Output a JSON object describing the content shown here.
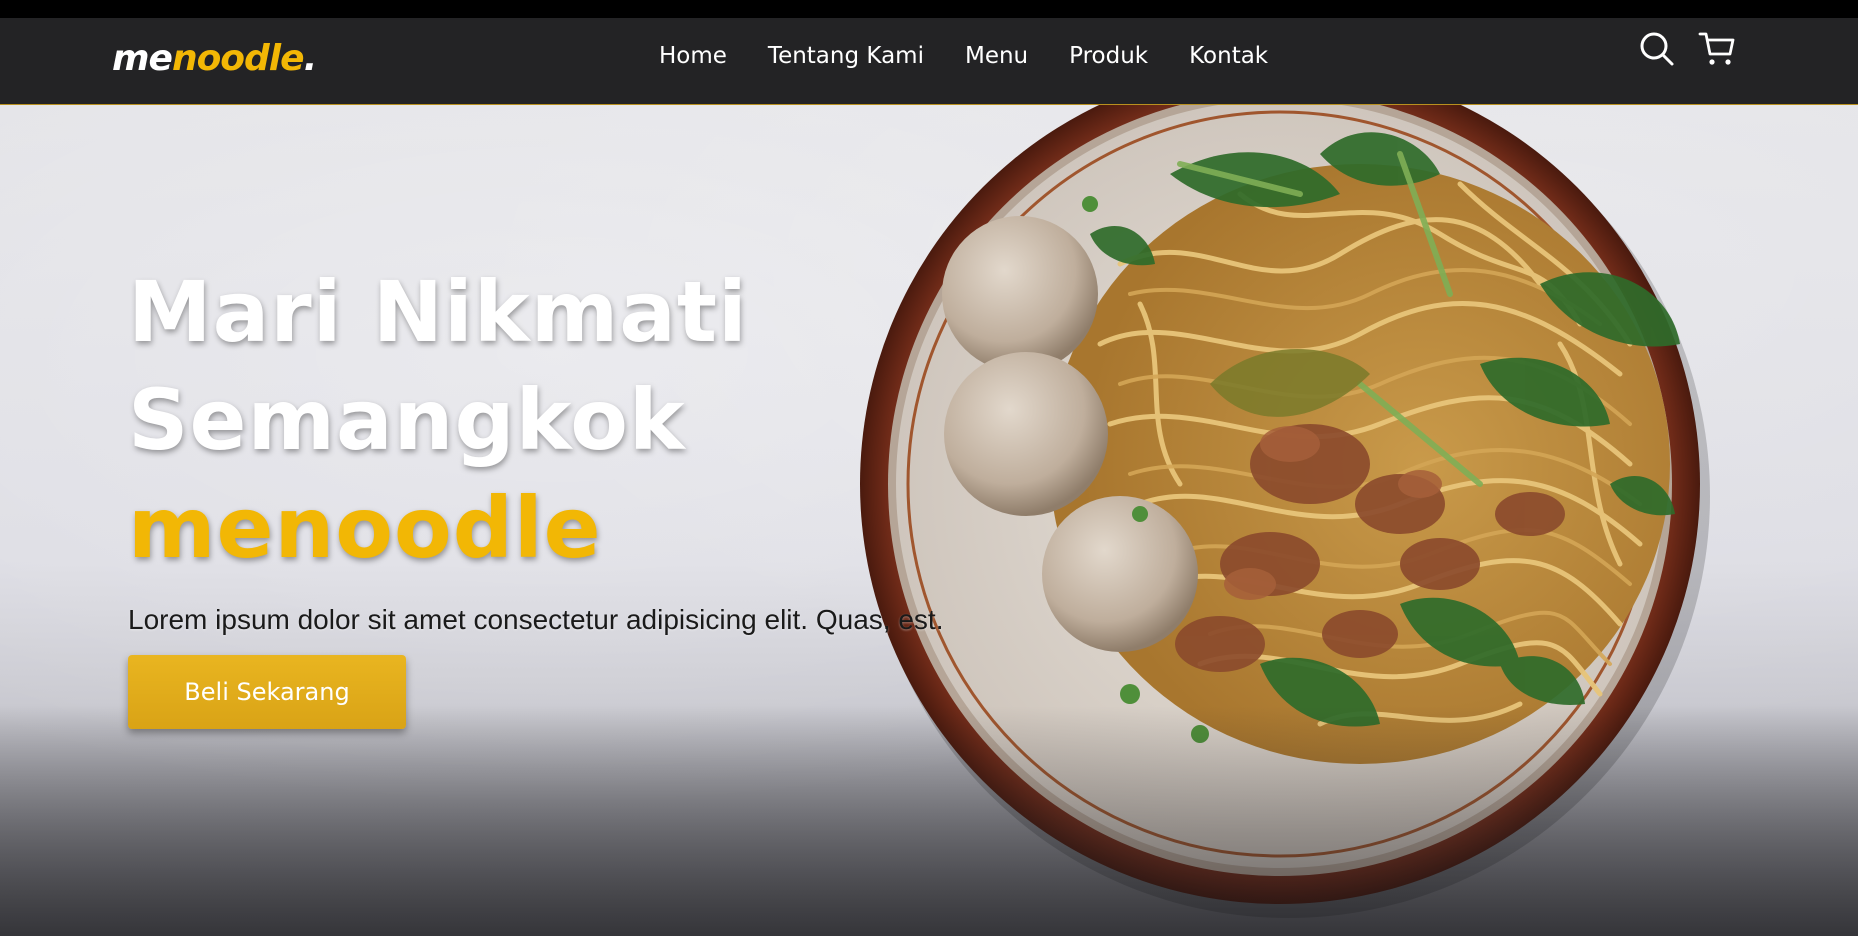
{
  "brand": {
    "logo_part1": "me",
    "logo_part2": "noodle",
    "logo_dot": ".",
    "accent_color": "#f2b705"
  },
  "nav": {
    "links": [
      {
        "label": "Home"
      },
      {
        "label": "Tentang Kami"
      },
      {
        "label": "Menu"
      },
      {
        "label": "Produk"
      },
      {
        "label": "Kontak"
      }
    ],
    "icons": [
      "search-icon",
      "shopping-cart-icon"
    ]
  },
  "hero": {
    "title_line1": "Mari Nikmati",
    "title_line2": "Semangkok",
    "title_line3": "menoodle",
    "description": "Lorem ipsum dolor sit amet consectetur adipisicing elit. Quas, est.",
    "cta_label": "Beli Sekarang",
    "image": "bowl-of-noodles-with-meatballs"
  },
  "colors": {
    "navbar_bg": "#242426",
    "cta_bg": "#e1ac1b",
    "title_text": "#ffffff"
  }
}
